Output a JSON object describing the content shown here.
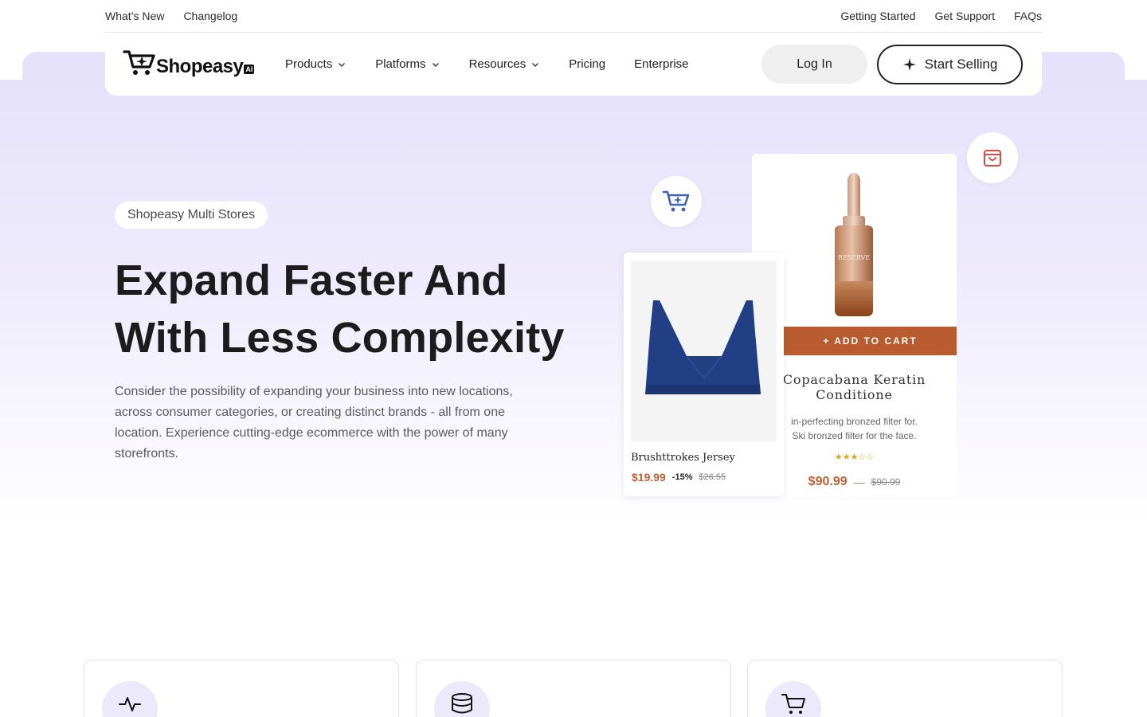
{
  "topbar": {
    "left_links": [
      "What’s New",
      "Changelog"
    ],
    "right_links": [
      "Getting Started",
      "Get Support",
      "FAQs"
    ]
  },
  "nav": {
    "logo_text": "Shopeasy",
    "logo_badge": "AI",
    "menu": [
      {
        "label": "Products",
        "has_dropdown": true
      },
      {
        "label": "Platforms",
        "has_dropdown": true
      },
      {
        "label": "Resources",
        "has_dropdown": true
      },
      {
        "label": "Pricing",
        "has_dropdown": false
      },
      {
        "label": "Enterprise",
        "has_dropdown": false
      }
    ],
    "login_label": "Log In",
    "start_label": "Start Selling"
  },
  "hero": {
    "badge": "Shopeasy Multi Stores",
    "title_line1": "Expand Faster And",
    "title_line2": "With Less Complexity",
    "description": "Consider the possibility of expanding your business into new locations, across consumer categories, or creating distinct brands - all from one location. Experience cutting-edge ecommerce with the power of many storefronts."
  },
  "products": {
    "serum": {
      "add_to_cart": "+ ADD TO CART",
      "name": "Copacabana Keratin Conditione",
      "description": "in-perfecting bronzed filter for. Ski bronzed filter for the face.",
      "stars": "★★★☆☆",
      "price": "$90.99",
      "separator": "—",
      "old_price": "$90.99",
      "bottle_label": "RESERVE"
    },
    "jersey": {
      "name": "Brushttrokes Jersey",
      "price": "$19.99",
      "discount": "-15%",
      "old_price": "$26.55"
    }
  },
  "colors": {
    "hero_bg": "#e6e2fb",
    "accent_orange": "#b85c2f",
    "cart_blue": "#3d63b8",
    "bag_red": "#e2483d"
  },
  "features": [
    {
      "icon": "activity-icon"
    },
    {
      "icon": "database-icon"
    },
    {
      "icon": "cart-icon"
    }
  ]
}
